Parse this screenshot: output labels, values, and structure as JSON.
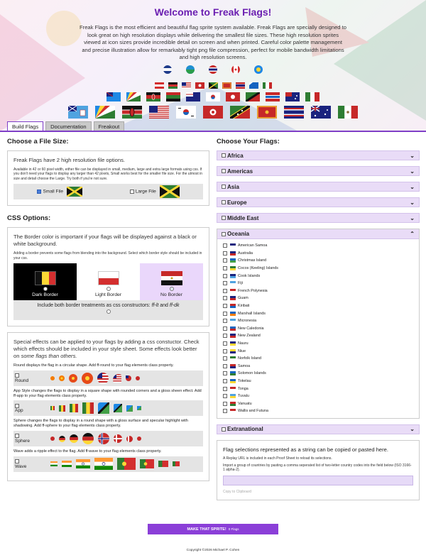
{
  "header": {
    "title": "Welcome to Freak Flags!",
    "intro": "Freak Flags is the most efficient and beautiful flag sprite system available. Freak Flags are specially designed to look great on high resolution displays while delivering the smallest file sizes. These high resolution sprites viewed at icon sizes provide incredible detail on screen and when printed. Careful color palette management and precise illustration allow for remarkably tight png file compression, perfect for mobile bandwidth limitations and high resolution screens."
  },
  "tabs": [
    "Build Flags",
    "Documentation",
    "Freakout"
  ],
  "file_size": {
    "heading": "Choose a File Size:",
    "lead": "Freak Flags have 2 high resolution file options.",
    "detail": "Available in 42 or 60 pixel width, either file can be displayed in small, medium, large and extra large formats using css. If you don't need your flags to display any larger than 42 pixels, Small works best for the smaller file size. For the utmost in size and detail choose the Large. Try both if you're not sure.",
    "small_label": "Small File",
    "large_label": "Large File"
  },
  "css": {
    "heading": "CSS Options:",
    "lead": "The Border color is important if your flags will be displayed against a black or white background.",
    "detail": "Adding a border prevents some flags from blending into the background. Select which border style should be included in your css.",
    "dark": "Dark Border",
    "light": "Light Border",
    "none": "No Border",
    "both_prefix": "Include both border treatments as css constructors: ",
    "both_a": "ff-lt",
    "both_and": " and ",
    "both_b": "ff-dk"
  },
  "effects": {
    "lead_a": "Special effects can be applied to your flags by adding a css constuctor. Check which effects should be included in your style sheet. Some effects look better on ",
    "lead_em": "some flags than others.",
    "round_desc": "Round displays the flag in a circular shape. Add ff-round to your flag elements class property.",
    "round": "Round",
    "app_desc": "App Style changes the flags to display in a square shape with rounded corners and a gloss sheen effect. Add ff-app to your flag elements class property.",
    "app": "App",
    "sphere_desc": "Sphere changes the flags to display in a round shape with a gloss surface and specular highlight with shadowing. Add ff-sphere to your flag elements class property.",
    "sphere": "Sphere",
    "wave_desc": "Wave adds a ripple effect to the flag. Add ff-wave to your flag elements class property.",
    "wave": "Wave"
  },
  "choose": {
    "heading": "Choose Your Flags:",
    "regions": [
      "Africa",
      "Americas",
      "Asia",
      "Europe",
      "Middle East"
    ],
    "open_region": "Oceania",
    "last_region": "Extranational",
    "countries": [
      "American Samoa",
      "Australia",
      "Christmas Island",
      "Cocos (Keeling) Islands",
      "Cook Islands",
      "Fiji",
      "French Polynesia",
      "Guam",
      "Kiribati",
      "Marshall Islands",
      "Micronesia",
      "New Caledonia",
      "New Zealand",
      "Nauru",
      "Niue",
      "Norfolk Island",
      "Samoa",
      "Solomon Islands",
      "Tokelau",
      "Tonga",
      "Tuvalu",
      "Vanuatu",
      "Wallis and Futuna"
    ]
  },
  "selection": {
    "lead": "Flag selections represented as a string can be copied or pasted here.",
    "replay": "A Replay URL is included in each Proof Sheet to reload its selections.",
    "import": "Import a group of countries by pasting a comma seperated list of two-letter country codes into the field below (ISO 3166-1 alpha-2).",
    "copy": "Copy to Clipboard"
  },
  "button": {
    "label": "MAKE THAT SPRITE!",
    "count": "0 Flags"
  },
  "footer": "Copyright ©2026 Michael P. Cohen",
  "colors": {
    "accent": "#7f3fc7",
    "button": "#8b3fd8",
    "accordion": "#e9dcf7"
  }
}
